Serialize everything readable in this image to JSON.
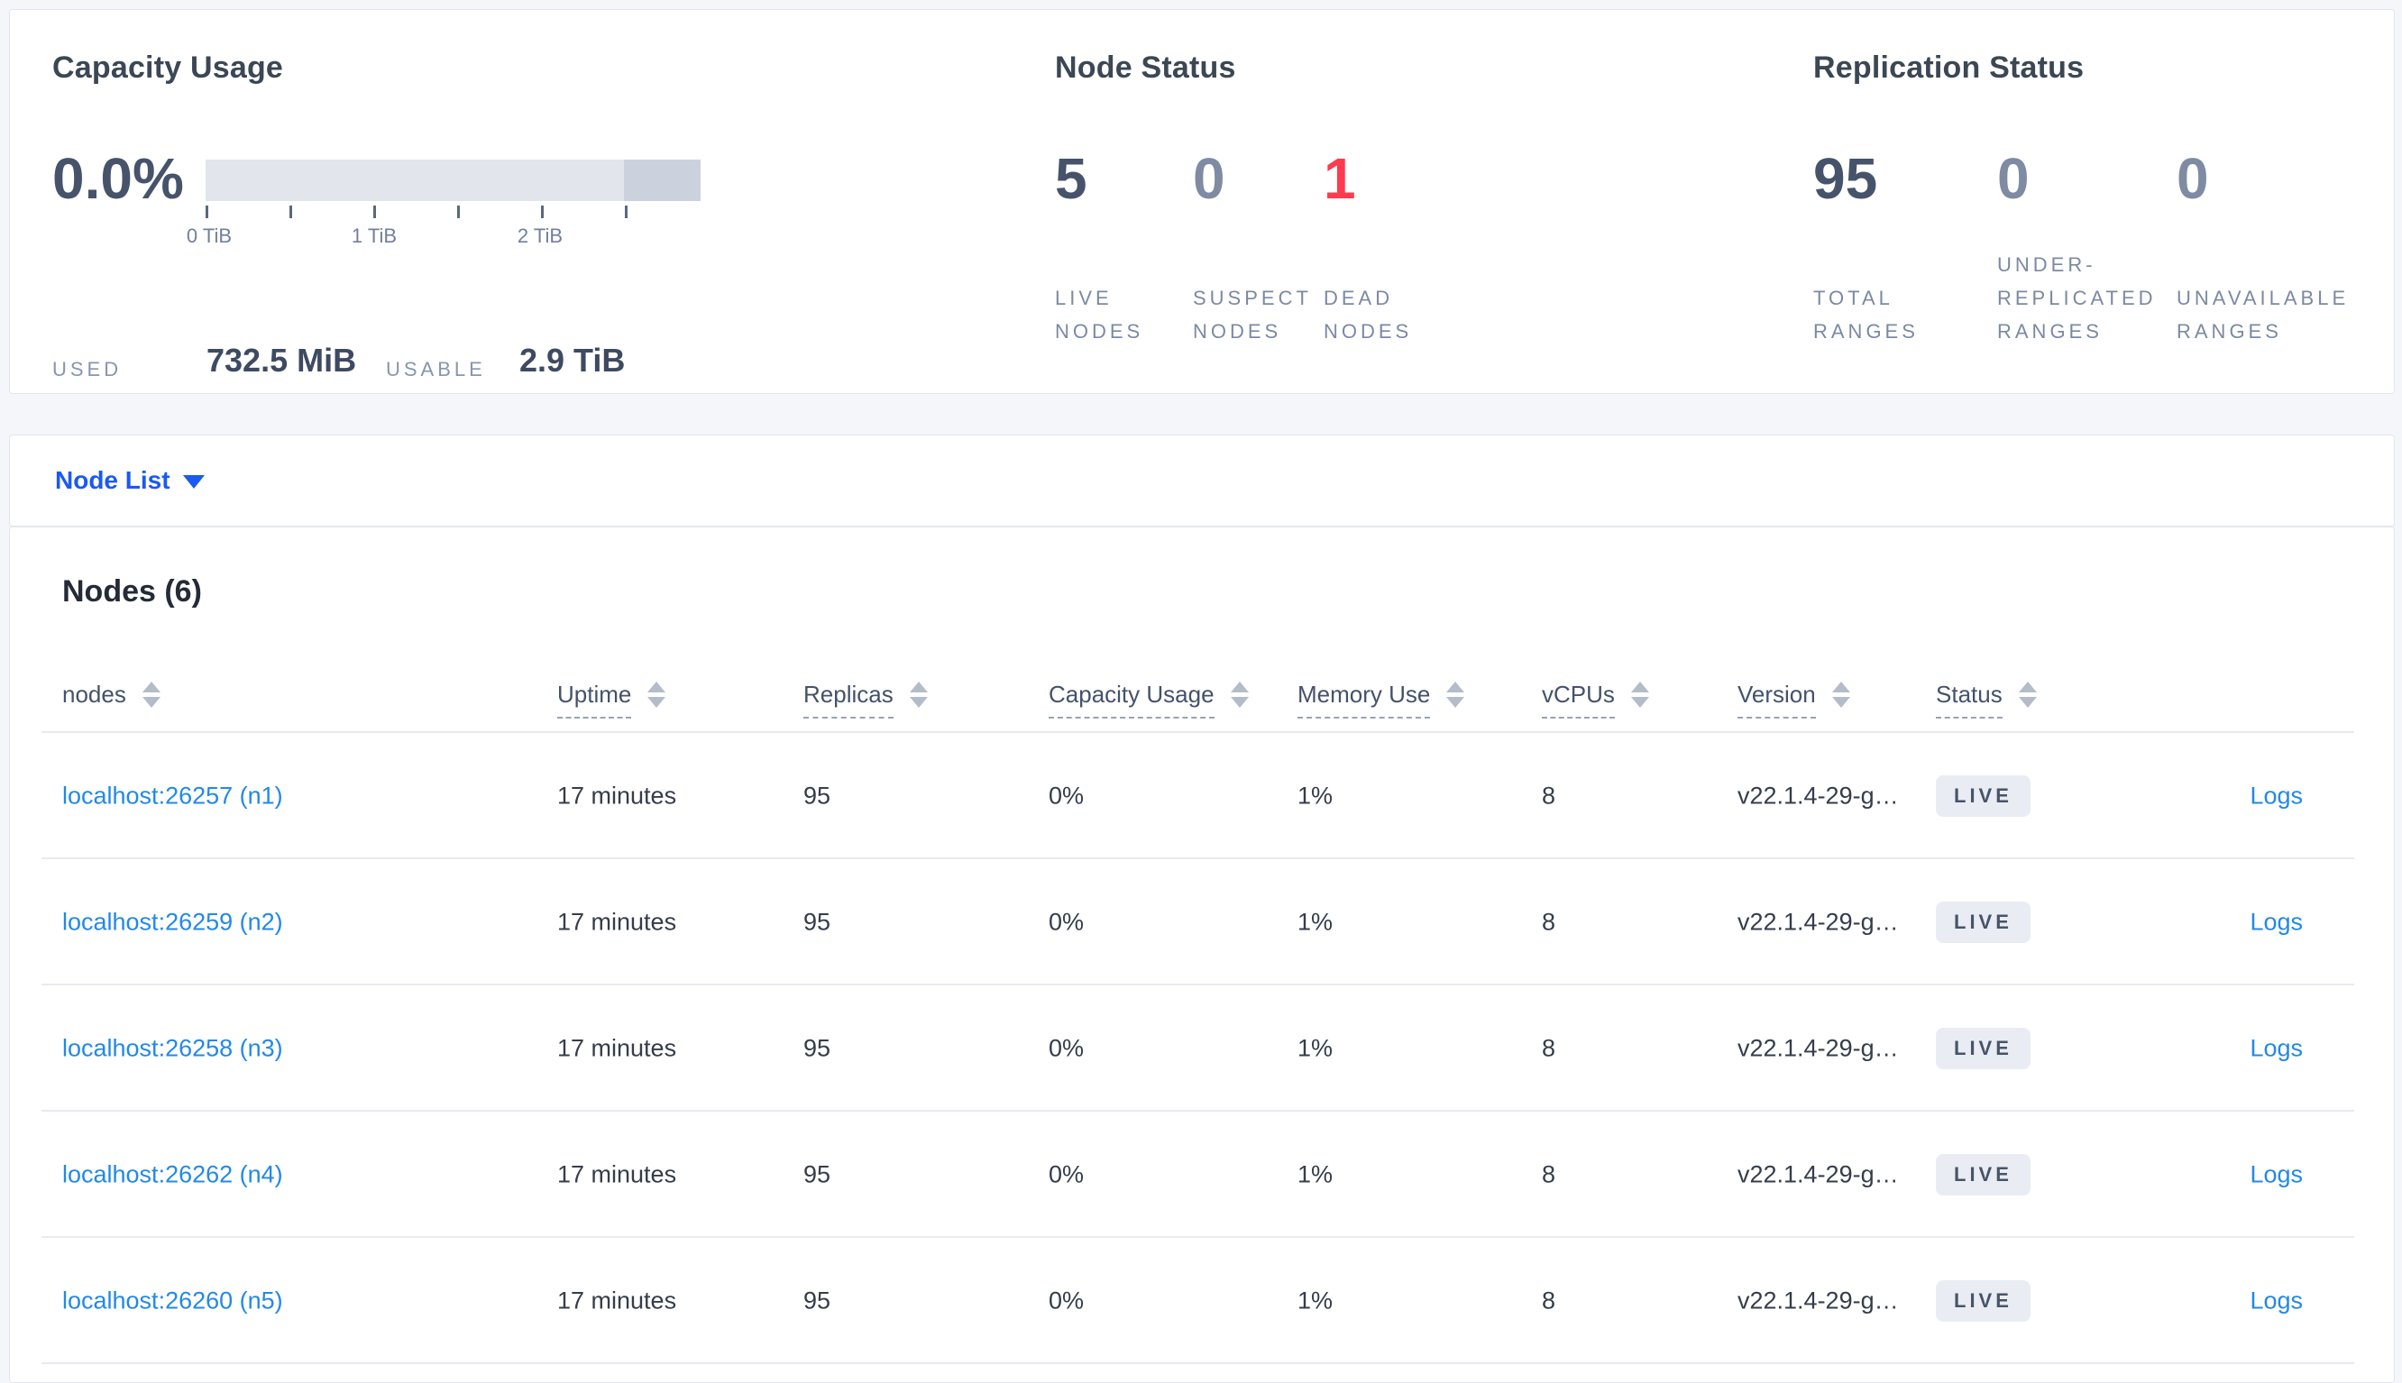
{
  "capacity": {
    "title": "Capacity Usage",
    "percent": "0.0%",
    "gauge_ticks": [
      "0 TiB",
      "1 TiB",
      "2 TiB"
    ],
    "used_label": "USED",
    "used_value": "732.5 MiB",
    "usable_label": "USABLE",
    "usable_value": "2.9 TiB"
  },
  "node_status": {
    "title": "Node Status",
    "stats": [
      {
        "value": "5",
        "line1": "LIVE",
        "line2": "NODES"
      },
      {
        "value": "0",
        "line1": "SUSPECT",
        "line2": "NODES"
      },
      {
        "value": "1",
        "line1": "DEAD",
        "line2": "NODES"
      }
    ]
  },
  "replication_status": {
    "title": "Replication Status",
    "stats": [
      {
        "value": "95",
        "line1": "TOTAL",
        "line2": "RANGES"
      },
      {
        "value": "0",
        "line1": "UNDER-",
        "line2": "REPLICATED",
        "line3": "RANGES"
      },
      {
        "value": "0",
        "line1": "UNAVAILABLE",
        "line2": "RANGES"
      }
    ]
  },
  "node_list": {
    "label": "Node List"
  },
  "nodes_table": {
    "heading": "Nodes (6)",
    "columns": {
      "nodes": "nodes",
      "uptime": "Uptime",
      "replicas": "Replicas",
      "capacity": "Capacity Usage",
      "memory": "Memory Use",
      "vcpus": "vCPUs",
      "version": "Version",
      "status": "Status"
    },
    "rows": [
      {
        "node": "localhost:26257 (n1)",
        "uptime": "17 minutes",
        "replicas": "95",
        "capacity": "0%",
        "memory": "1%",
        "vcpus": "8",
        "version": "v22.1.4-29-g…",
        "status": "LIVE",
        "logs": "Logs"
      },
      {
        "node": "localhost:26259 (n2)",
        "uptime": "17 minutes",
        "replicas": "95",
        "capacity": "0%",
        "memory": "1%",
        "vcpus": "8",
        "version": "v22.1.4-29-g…",
        "status": "LIVE",
        "logs": "Logs"
      },
      {
        "node": "localhost:26258 (n3)",
        "uptime": "17 minutes",
        "replicas": "95",
        "capacity": "0%",
        "memory": "1%",
        "vcpus": "8",
        "version": "v22.1.4-29-g…",
        "status": "LIVE",
        "logs": "Logs"
      },
      {
        "node": "localhost:26262 (n4)",
        "uptime": "17 minutes",
        "replicas": "95",
        "capacity": "0%",
        "memory": "1%",
        "vcpus": "8",
        "version": "v22.1.4-29-g…",
        "status": "LIVE",
        "logs": "Logs"
      },
      {
        "node": "localhost:26260 (n5)",
        "uptime": "17 minutes",
        "replicas": "95",
        "capacity": "0%",
        "memory": "1%",
        "vcpus": "8",
        "version": "v22.1.4-29-g…",
        "status": "LIVE",
        "logs": "Logs"
      }
    ]
  },
  "colors": {
    "accent_blue": "#1b59f2",
    "link_blue": "#2289e8",
    "dead_red": "#ff3b4f",
    "stat_dark": "#46536b",
    "stat_muted": "#7e8ba3",
    "badge_bg": "#e9edf3",
    "gauge_light": "#e2e5ec",
    "gauge_dark": "#ccd2dd"
  }
}
